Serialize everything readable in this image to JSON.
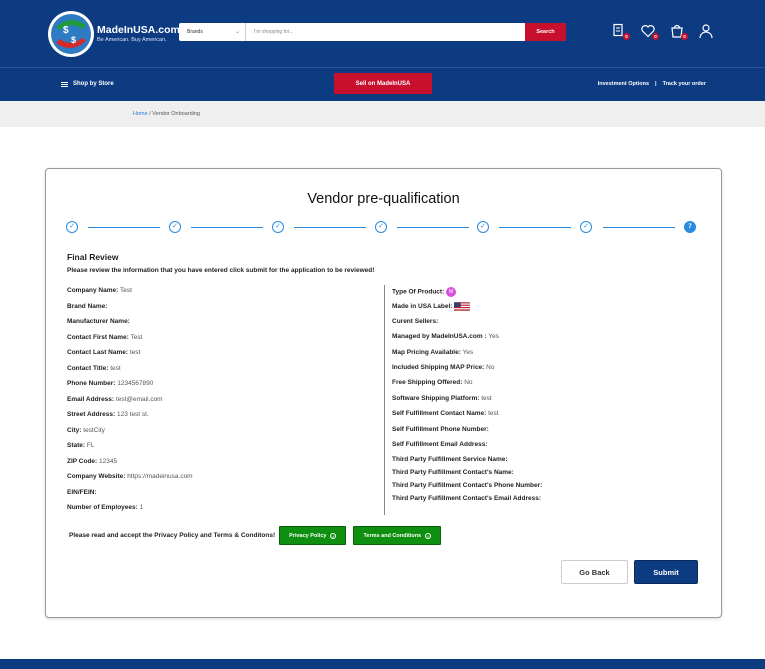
{
  "header": {
    "brand_name": "MadeInUSA.com",
    "brand_tagline": "Be American. Buy American.",
    "search": {
      "category_selected": "Brands",
      "placeholder": "I'm shopping for...",
      "button_label": "Search"
    },
    "icons": {
      "compare_count": "0",
      "wishlist_count": "0",
      "cart_count": "0"
    }
  },
  "nav": {
    "shop_by_store": "Shop by Store",
    "sell_button": "Sell on MadeInUSA",
    "investment_options": "Investment Options",
    "separator": "|",
    "track_order": "Track your order"
  },
  "breadcrumb": {
    "home": "Home",
    "separator": "/",
    "current": "Vendor Onboarding"
  },
  "form": {
    "title": "Vendor pre-qualification",
    "steps": [
      "✓",
      "✓",
      "✓",
      "✓",
      "✓",
      "✓",
      "7"
    ],
    "review_title": "Final Review",
    "review_subtitle": "Please review the information that you have entered click submit for the application to be reviewed!",
    "left_fields": [
      {
        "label": "Company Name:",
        "value": "Test"
      },
      {
        "label": "Brand Name:",
        "value": ""
      },
      {
        "label": "Manufacturer Name:",
        "value": ""
      },
      {
        "label": "Contact First Name:",
        "value": "Test"
      },
      {
        "label": "Contact Last Name:",
        "value": "test"
      },
      {
        "label": "Contact Title:",
        "value": "test"
      },
      {
        "label": "Phone Number:",
        "value": "1234567890"
      },
      {
        "label": "Email Address:",
        "value": "test@email.com"
      },
      {
        "label": "Street Address:",
        "value": "123 test st."
      },
      {
        "label": "City:",
        "value": "testCity"
      },
      {
        "label": "State:",
        "value": "FL"
      },
      {
        "label": "ZIP Code:",
        "value": "12345"
      },
      {
        "label": "Company Website:",
        "value": "https://madeinusa.com"
      },
      {
        "label": "EIN/FEIN:",
        "value": ""
      },
      {
        "label": "Number of Employees:",
        "value": "1"
      }
    ],
    "right_fields": [
      {
        "label": "Type Of Product:",
        "value": "",
        "badge": "M"
      },
      {
        "label": "Made in USA Label:",
        "value": "",
        "icon": "us-flag-icon"
      },
      {
        "label": "Curent Sellers:",
        "value": ""
      },
      {
        "label": "Managed by MadeInUSA.com :",
        "value": "Yes"
      },
      {
        "label": "Map Pricing Available:",
        "value": "Yes"
      },
      {
        "label": "Included Shipping MAP Price:",
        "value": "No"
      },
      {
        "label": "Free Shipping Offered:",
        "value": "No"
      },
      {
        "label": "Software Shipping Platform:",
        "value": "test"
      },
      {
        "label": "Self Fulfillment Contact Name:",
        "value": "test"
      },
      {
        "label": "Self Fulfillment Phone Number:",
        "value": ""
      },
      {
        "label": "Self Fulfillment Email Address:",
        "value": ""
      },
      {
        "label": "Third Party Fulfillment Service Name:",
        "value": ""
      },
      {
        "label": "Third Party Fulfillment Contact's Name:",
        "value": ""
      },
      {
        "label": "Third Party Fulfillment Contact's Phone Number:",
        "value": ""
      },
      {
        "label": "Third Party Fulfillment Contact's Email Address:",
        "value": ""
      }
    ],
    "policy_text": "Please read and accept the Privacy Policy and Terms & Conditons!",
    "privacy_button": "Privacy Policy",
    "terms_button": "Terms and Conditions",
    "go_back": "Go Back",
    "submit": "Submit"
  },
  "colors": {
    "primary_navy": "#0c3b82",
    "accent_red": "#c8102e",
    "step_blue": "#2a8be0",
    "accept_green": "#0f8f0f"
  }
}
